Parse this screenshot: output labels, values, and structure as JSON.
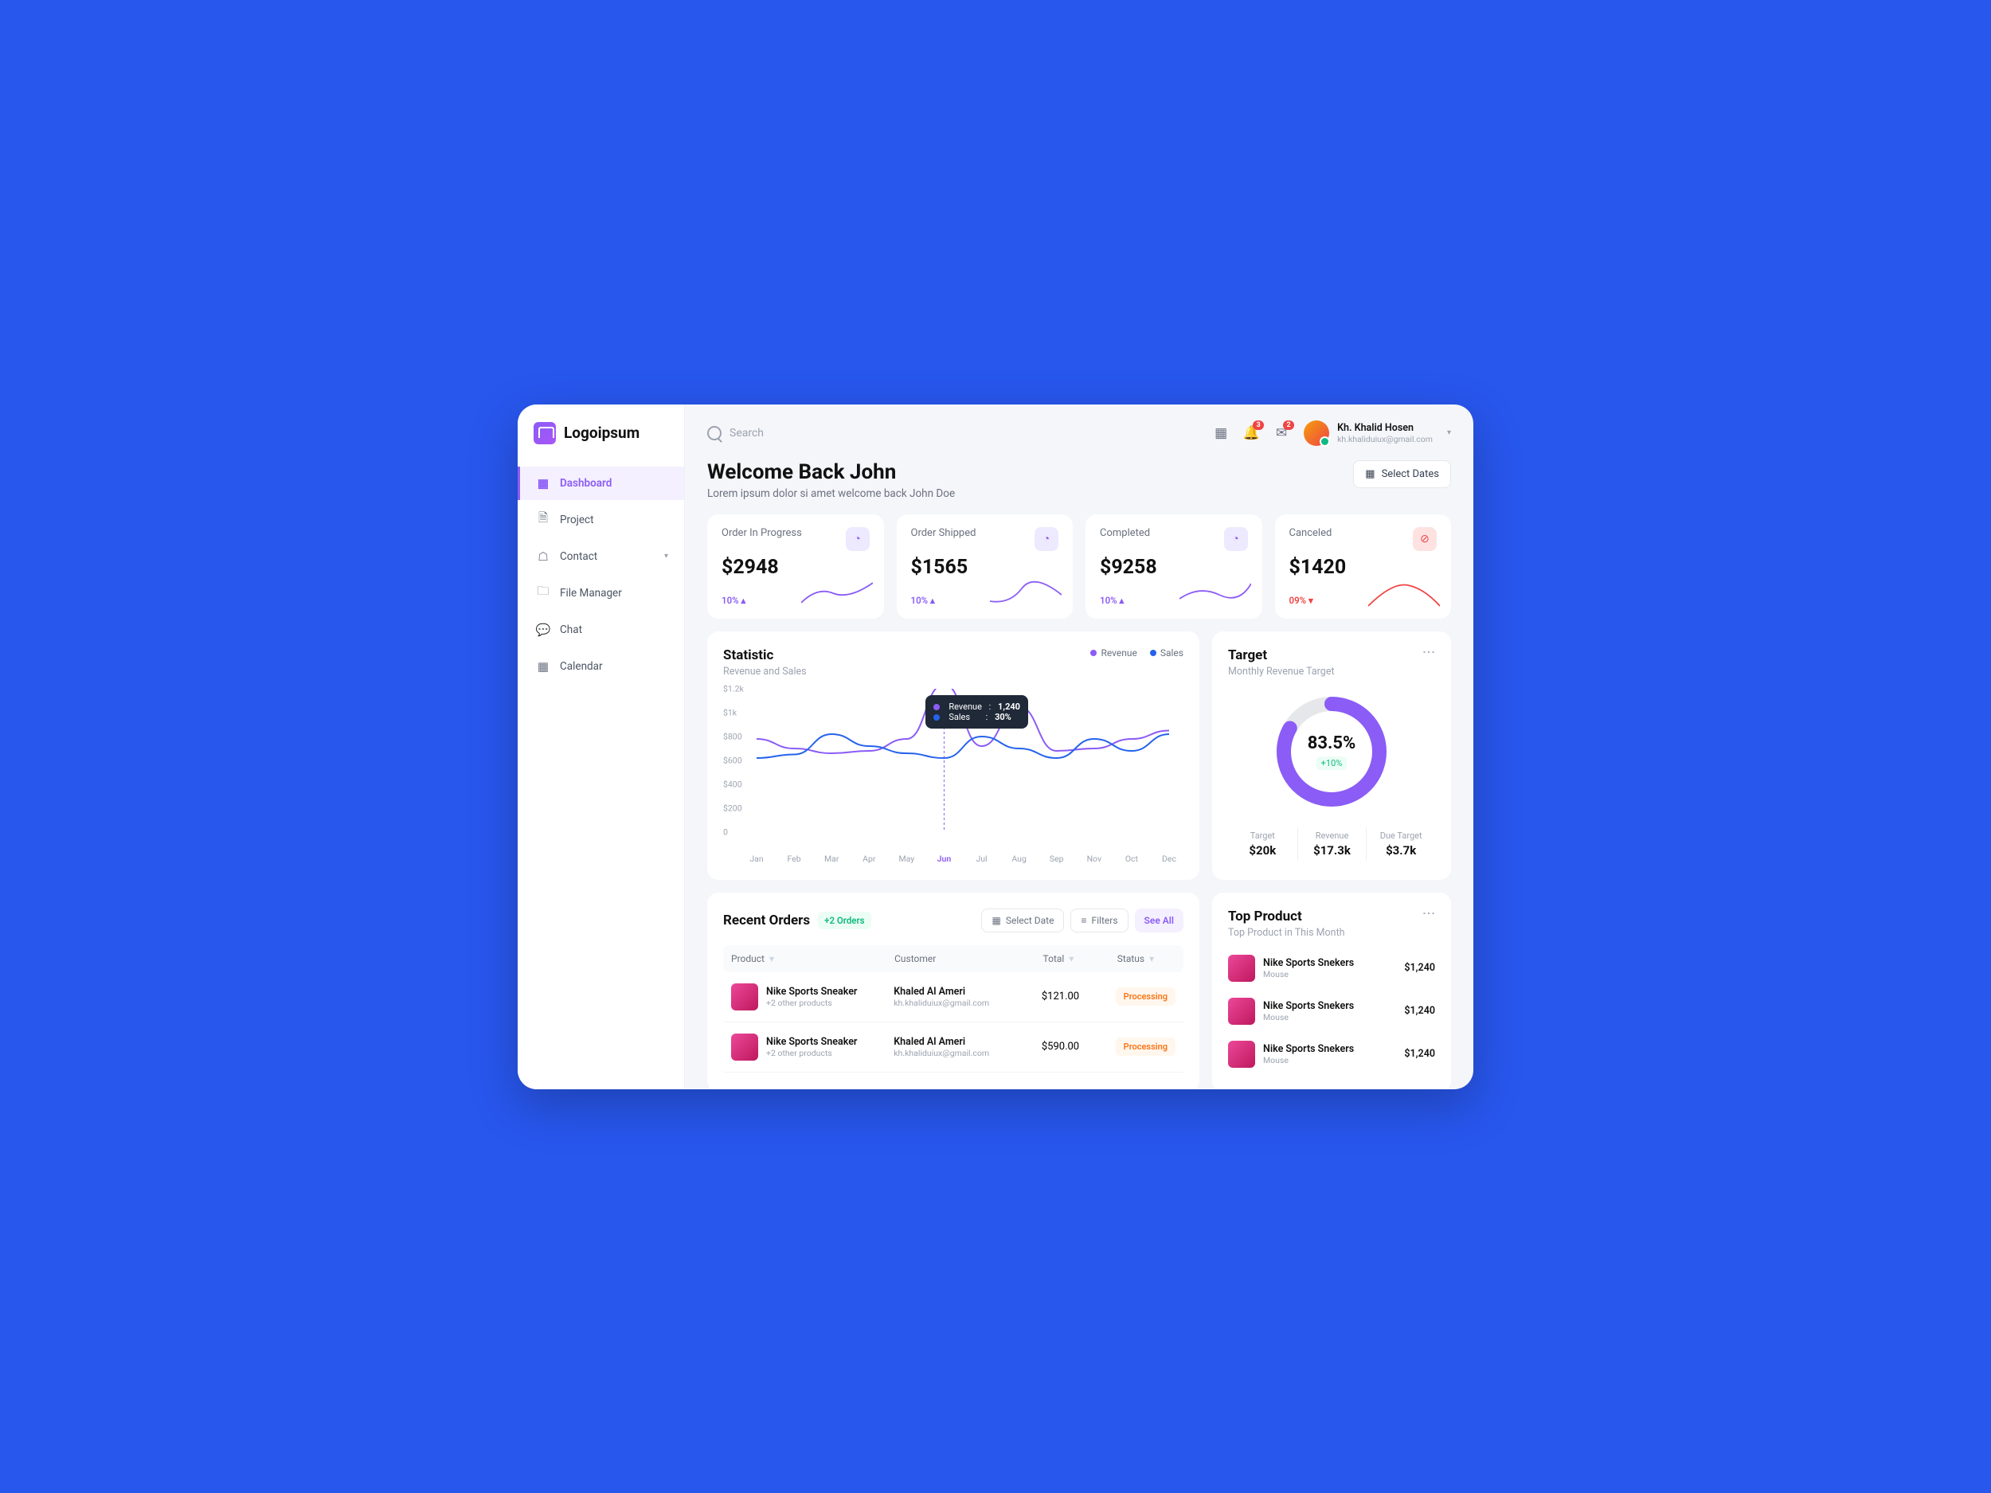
{
  "brand": "Logoipsum",
  "search": {
    "placeholder": "Search"
  },
  "notifications": {
    "bell": "3",
    "mail": "2"
  },
  "user": {
    "name": "Kh. Khalid Hosen",
    "email": "kh.khaliduiux@gmail.com"
  },
  "sidebar": {
    "items": [
      {
        "label": "Dashboard"
      },
      {
        "label": "Project"
      },
      {
        "label": "Contact"
      },
      {
        "label": "File Manager"
      },
      {
        "label": "Chat"
      },
      {
        "label": "Calendar"
      }
    ]
  },
  "header": {
    "title": "Welcome Back John",
    "subtitle": "Lorem ipsum dolor si amet welcome back John Doe",
    "select_dates": "Select Dates"
  },
  "stats": [
    {
      "label": "Order In Progress",
      "value": "$2948",
      "pct": "10% ▴"
    },
    {
      "label": "Order Shipped",
      "value": "$1565",
      "pct": "10% ▴"
    },
    {
      "label": "Completed",
      "value": "$9258",
      "pct": "10% ▴"
    },
    {
      "label": "Canceled",
      "value": "$1420",
      "pct": "09% ▾"
    }
  ],
  "chart_data": {
    "type": "line",
    "title": "Statistic",
    "subtitle": "Revenue and Sales",
    "categories": [
      "Jan",
      "Feb",
      "Mar",
      "Apr",
      "May",
      "Jun",
      "Jul",
      "Aug",
      "Sep",
      "Nov",
      "Oct",
      "Dec"
    ],
    "ylabel": "",
    "ylim": [
      0,
      1200
    ],
    "yticks": [
      "$1.2k",
      "$1k",
      "$800",
      "$600",
      "$400",
      "$200",
      "0"
    ],
    "series": [
      {
        "name": "Revenue",
        "color": "#8b5cf6",
        "values": [
          780,
          700,
          660,
          680,
          780,
          1240,
          720,
          1050,
          680,
          700,
          780,
          850
        ]
      },
      {
        "name": "Sales",
        "color": "#2563eb",
        "values": [
          620,
          650,
          820,
          720,
          660,
          620,
          800,
          700,
          620,
          780,
          680,
          820
        ]
      }
    ],
    "tooltip": {
      "month": "Jun",
      "revenue_label": "Revenue",
      "revenue_value": "1,240",
      "sales_label": "Sales",
      "sales_value": "30%"
    }
  },
  "target": {
    "title": "Target",
    "subtitle": "Monthly Revenue Target",
    "percent": "83.5%",
    "delta": "+10%",
    "metrics": [
      {
        "label": "Target",
        "value": "$20k"
      },
      {
        "label": "Revenue",
        "value": "$17.3k"
      },
      {
        "label": "Due Target",
        "value": "$3.7k"
      }
    ]
  },
  "orders": {
    "title": "Recent Orders",
    "badge": "+2 Orders",
    "select_date": "Select Date",
    "filters": "Filters",
    "see_all": "See All",
    "columns": {
      "product": "Product",
      "customer": "Customer",
      "total": "Total",
      "status": "Status"
    },
    "rows": [
      {
        "product": "Nike Sports Sneaker",
        "sub": "+2 other products",
        "customer": "Khaled Al Ameri",
        "email": "kh.khaliduiux@gmail.com",
        "total": "$121.00",
        "status": "Processing"
      },
      {
        "product": "Nike Sports Sneaker",
        "sub": "+2 other products",
        "customer": "Khaled Al Ameri",
        "email": "kh.khaliduiux@gmail.com",
        "total": "$590.00",
        "status": "Processing"
      }
    ]
  },
  "top_products": {
    "title": "Top Product",
    "subtitle": "Top Product in This Month",
    "items": [
      {
        "name": "Nike Sports Snekers",
        "sub": "Mouse",
        "price": "$1,240"
      },
      {
        "name": "Nike Sports Snekers",
        "sub": "Mouse",
        "price": "$1,240"
      },
      {
        "name": "Nike Sports Snekers",
        "sub": "Mouse",
        "price": "$1,240"
      }
    ]
  },
  "colors": {
    "accent": "#8b5cf6",
    "blue": "#2563eb",
    "red": "#ef4444",
    "green": "#10b981",
    "orange": "#f97316"
  }
}
